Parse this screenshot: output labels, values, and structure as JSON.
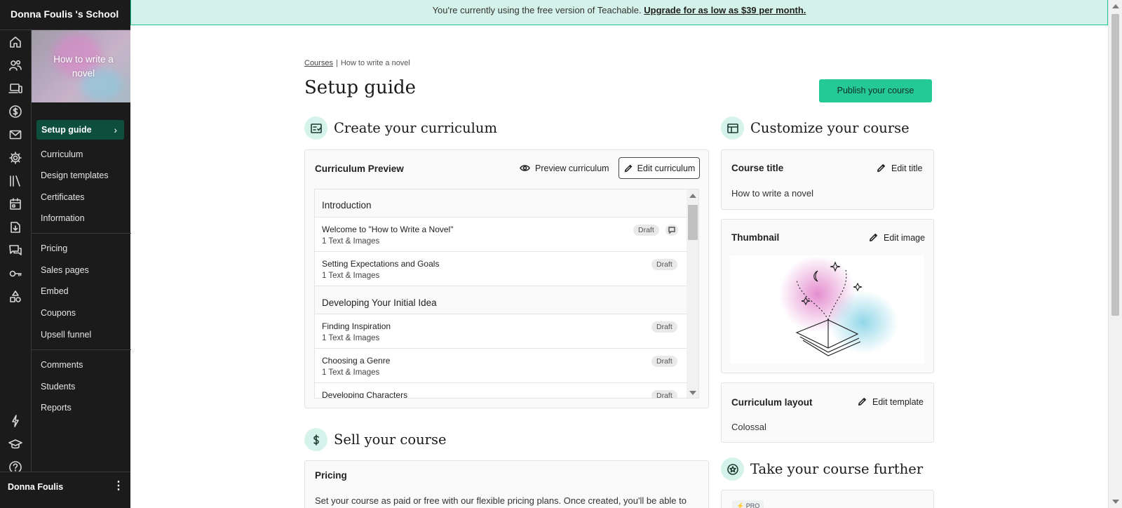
{
  "school_name": "Donna Foulis 's School",
  "banner": {
    "text": "You're currently using the free version of Teachable.",
    "link": "Upgrade for as low as $39 per month."
  },
  "rail_icons": [
    "home-icon",
    "users-icon",
    "courses-icon",
    "dollar-icon",
    "mail-icon",
    "settings-icon",
    "library-icon",
    "calendar-icon",
    "download-icon",
    "comments-icon",
    "key-icon",
    "shapes-icon",
    "lightning-icon",
    "graduation-icon",
    "help-icon"
  ],
  "course_sidebar": {
    "course_title": "How to write a novel",
    "active_item": "Setup guide",
    "group1": [
      "Curriculum",
      "Design templates",
      "Certificates",
      "Information"
    ],
    "group2": [
      "Pricing",
      "Sales pages",
      "Embed",
      "Coupons",
      "Upsell funnel"
    ],
    "group3": [
      "Comments",
      "Students",
      "Reports"
    ]
  },
  "user": {
    "name": "Donna Foulis"
  },
  "breadcrumb": {
    "root": "Courses",
    "separator": "|",
    "current": "How to write a novel"
  },
  "page_title": "Setup guide",
  "publish_label": "Publish your course",
  "curriculum": {
    "section_title": "Create your curriculum",
    "card_title": "Curriculum Preview",
    "preview_label": "Preview curriculum",
    "edit_label": "Edit curriculum",
    "sections": [
      {
        "name": "Introduction",
        "lectures": [
          {
            "title": "Welcome to \"How to Write a Novel\"",
            "sub": "1 Text & Images",
            "status": "Draft",
            "has_comment": true
          },
          {
            "title": "Setting Expectations and Goals",
            "sub": "1 Text & Images",
            "status": "Draft",
            "has_comment": false
          }
        ]
      },
      {
        "name": "Developing Your Initial Idea",
        "lectures": [
          {
            "title": "Finding Inspiration",
            "sub": "1 Text & Images",
            "status": "Draft",
            "has_comment": false
          },
          {
            "title": "Choosing a Genre",
            "sub": "1 Text & Images",
            "status": "Draft",
            "has_comment": false
          },
          {
            "title": "Developing Characters",
            "sub": "",
            "status": "Draft",
            "has_comment": false
          }
        ]
      }
    ]
  },
  "sell": {
    "section_title": "Sell your course",
    "card_title": "Pricing",
    "description": "Set your course as paid or free with our flexible pricing plans. Once created, you'll be able to"
  },
  "customize": {
    "section_title": "Customize your course",
    "course_title_label": "Course title",
    "edit_title_label": "Edit title",
    "course_title_value": "How to write a novel",
    "thumbnail_label": "Thumbnail",
    "edit_image_label": "Edit image",
    "layout_label": "Curriculum layout",
    "edit_template_label": "Edit template",
    "layout_value": "Colossal"
  },
  "further": {
    "section_title": "Take your course further",
    "badge": "PRO"
  }
}
